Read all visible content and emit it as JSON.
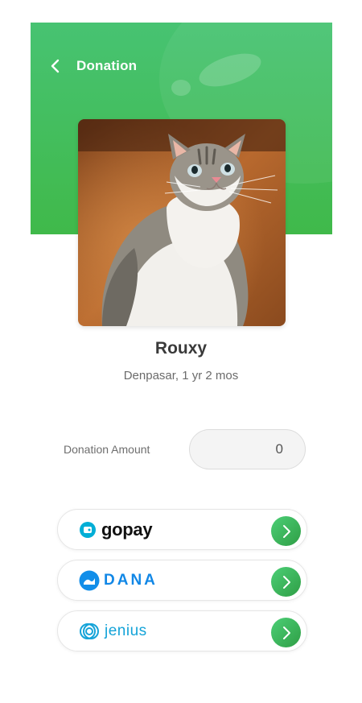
{
  "header": {
    "title": "Donation",
    "back_icon": "chevron-left-icon",
    "colors": {
      "green_top": "#47c372",
      "green_bottom": "#40b94a"
    }
  },
  "pet": {
    "photo": "cat-photo",
    "name": "Rouxy",
    "meta": "Denpasar, 1 yr 2 mos"
  },
  "donation": {
    "label": "Donation Amount",
    "value": "0"
  },
  "payment_methods": [
    {
      "id": "gopay",
      "label": "gopay",
      "icon": "gopay-logo-icon"
    },
    {
      "id": "dana",
      "label": "DANA",
      "icon": "dana-logo-icon"
    },
    {
      "id": "jenius",
      "label": "jenius",
      "icon": "jenius-logo-icon"
    }
  ],
  "go_icon": "chevron-right-icon",
  "colors": {
    "accent": "#3fb350",
    "text_dark": "#3a3a3a",
    "text_muted": "#6b6b6b"
  }
}
